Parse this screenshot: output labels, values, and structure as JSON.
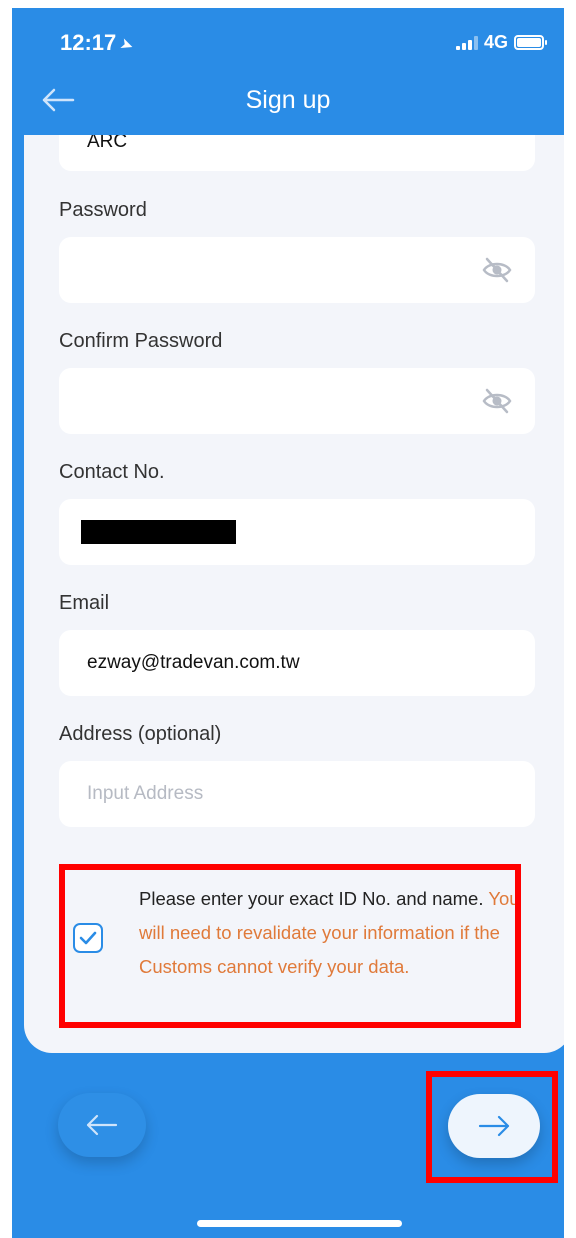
{
  "status_bar": {
    "time": "12:17",
    "network": "4G"
  },
  "nav": {
    "title": "Sign up"
  },
  "form": {
    "id_type_value": "ARC",
    "password_label": "Password",
    "confirm_password_label": "Confirm Password",
    "contact_label": "Contact No.",
    "email_label": "Email",
    "email_value": "ezway@tradevan.com.tw",
    "address_label": "Address (optional)",
    "address_placeholder": "Input Address"
  },
  "consent": {
    "checked": true,
    "text_normal": "Please enter your exact ID No. and name.",
    "text_warning": "You will need to revalidate your information if the Customs cannot verify your data."
  },
  "colors": {
    "primary": "#2a8ce6",
    "card_bg": "#f3f5fa",
    "warning": "#e07a3a",
    "highlight": "#ff0000"
  }
}
